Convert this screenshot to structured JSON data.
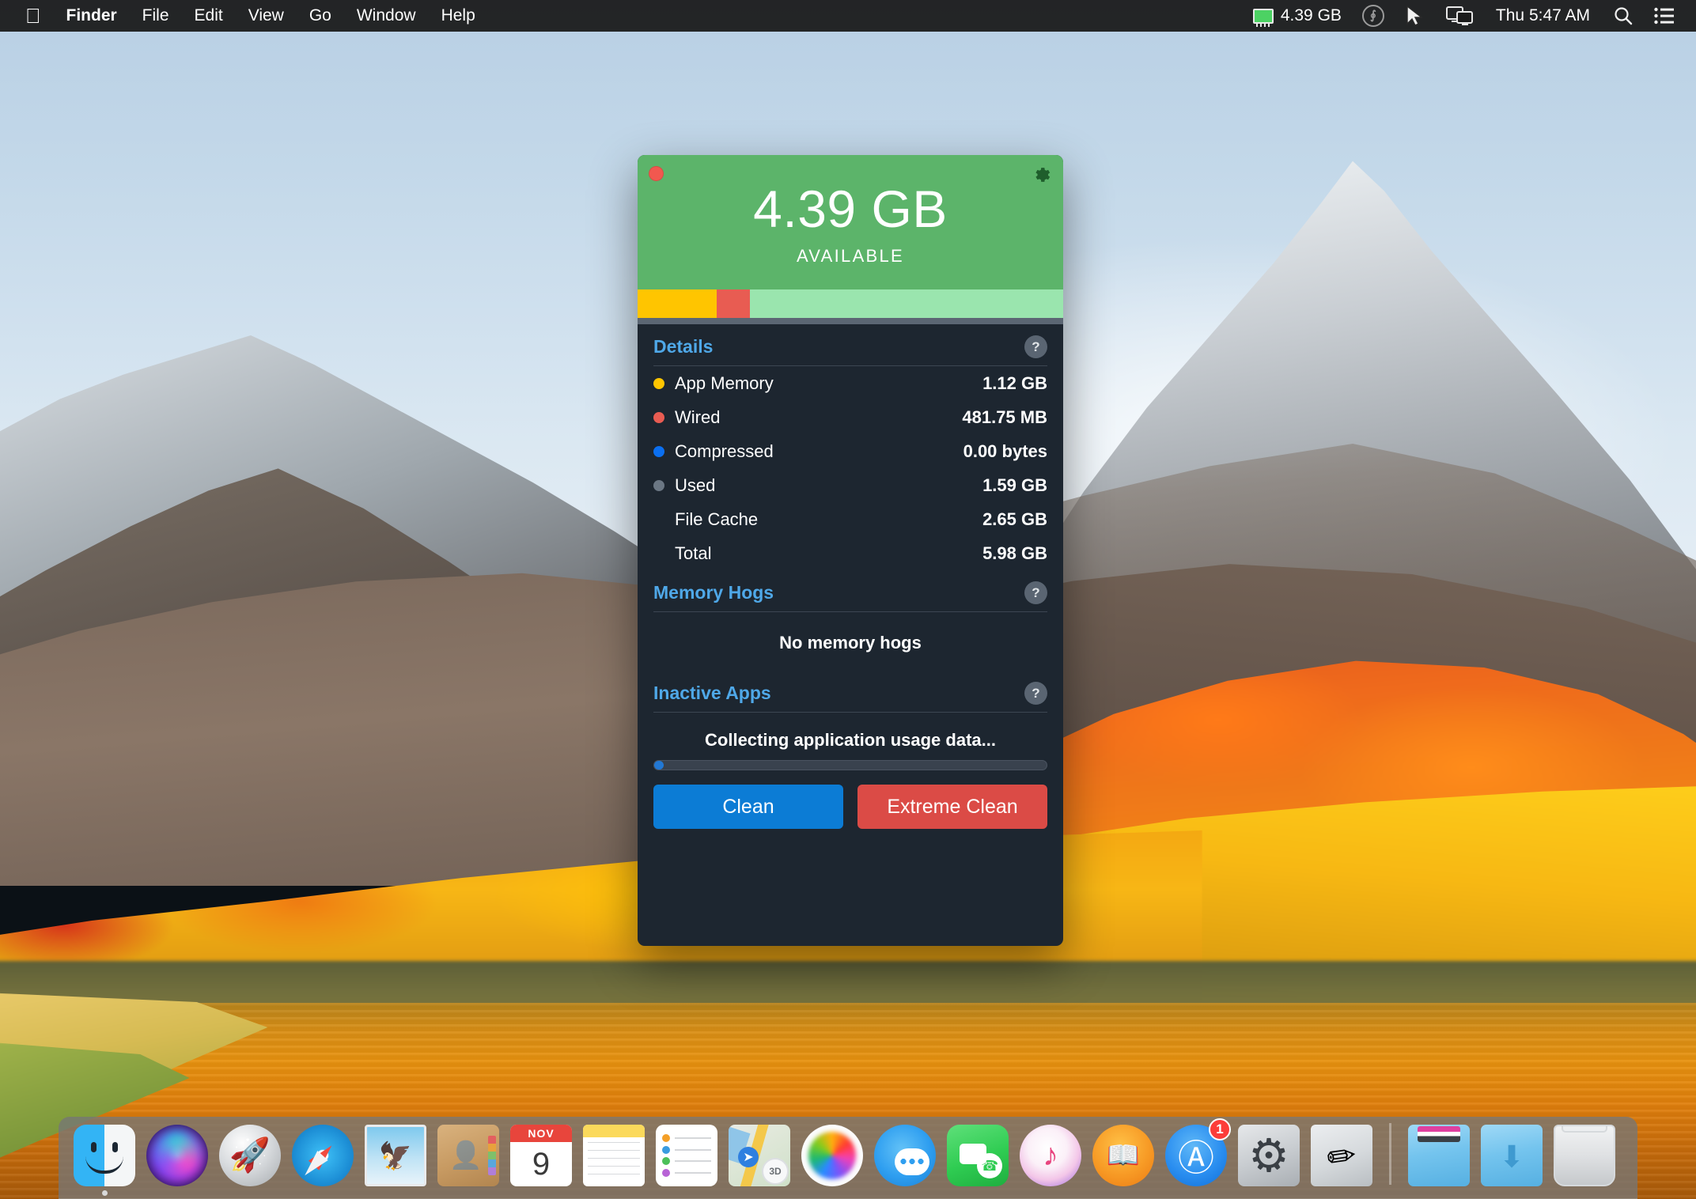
{
  "menubar": {
    "apple_logo": "apple-logo",
    "items": [
      {
        "label": "Finder",
        "bold": true
      },
      {
        "label": "File",
        "bold": false
      },
      {
        "label": "Edit",
        "bold": false
      },
      {
        "label": "View",
        "bold": false
      },
      {
        "label": "Go",
        "bold": false
      },
      {
        "label": "Window",
        "bold": false
      },
      {
        "label": "Help",
        "bold": false
      }
    ],
    "status": {
      "memory_value": "4.39 GB",
      "creative_cloud": "cc-icon",
      "pointer": "pointer-icon",
      "screen_sharing": "screen-sharing-icon",
      "clock": "Thu 5:47 AM",
      "search": "search-icon",
      "notification_center": "list-icon"
    }
  },
  "app_window": {
    "close_button": "close-button",
    "gear_button": "gear-icon",
    "available_value": "4.39 GB",
    "available_label": "AVAILABLE",
    "memory_bar": {
      "segments": [
        {
          "name": "app-memory",
          "color": "#ffc500",
          "percent": 18.6
        },
        {
          "name": "wired",
          "color": "#e85c52",
          "percent": 7.8
        },
        {
          "name": "available",
          "color": "#9ae5ae",
          "percent": 73.6
        }
      ],
      "base_color": "#5b6673"
    },
    "details": {
      "title": "Details",
      "help": "?",
      "rows": [
        {
          "label": "App Memory",
          "value": "1.12 GB",
          "dot": "#ffc500"
        },
        {
          "label": "Wired",
          "value": "481.75 MB",
          "dot": "#e85c52"
        },
        {
          "label": "Compressed",
          "value": "0.00 bytes",
          "dot": "#0b6ff0"
        },
        {
          "label": "Used",
          "value": "1.59 GB",
          "dot": "#6b7784"
        },
        {
          "label": "File Cache",
          "value": "2.65 GB",
          "dot": ""
        },
        {
          "label": "Total",
          "value": "5.98 GB",
          "dot": ""
        }
      ]
    },
    "memory_hogs": {
      "title": "Memory Hogs",
      "help": "?",
      "empty_message": "No memory hogs"
    },
    "inactive_apps": {
      "title": "Inactive Apps",
      "help": "?",
      "status_message": "Collecting application usage data...",
      "progress_percent": 2.5
    },
    "buttons": {
      "clean": "Clean",
      "extreme_clean": "Extreme Clean"
    }
  },
  "dock": {
    "items": [
      {
        "name": "finder",
        "icon": "finder-icon",
        "running": true
      },
      {
        "name": "siri",
        "icon": "siri-icon",
        "running": false
      },
      {
        "name": "launchpad",
        "icon": "launchpad-icon",
        "running": false
      },
      {
        "name": "safari",
        "icon": "safari-icon",
        "running": false
      },
      {
        "name": "mail",
        "icon": "mail-icon",
        "running": false
      },
      {
        "name": "contacts",
        "icon": "contacts-icon",
        "running": false
      },
      {
        "name": "calendar",
        "icon": "calendar-icon",
        "running": false,
        "month": "NOV",
        "day": "9"
      },
      {
        "name": "notes",
        "icon": "notes-icon",
        "running": false
      },
      {
        "name": "reminders",
        "icon": "reminders-icon",
        "running": false
      },
      {
        "name": "maps",
        "icon": "maps-icon",
        "running": false,
        "badge3d": "3D"
      },
      {
        "name": "photos",
        "icon": "photos-icon",
        "running": false
      },
      {
        "name": "messages",
        "icon": "messages-icon",
        "running": false
      },
      {
        "name": "facetime",
        "icon": "facetime-icon",
        "running": false
      },
      {
        "name": "itunes",
        "icon": "itunes-icon",
        "running": false
      },
      {
        "name": "ibooks",
        "icon": "ibooks-icon",
        "running": false
      },
      {
        "name": "app-store",
        "icon": "app-store-icon",
        "running": false,
        "badge": "1"
      },
      {
        "name": "system-preferences",
        "icon": "system-preferences-icon",
        "running": false
      },
      {
        "name": "textedit",
        "icon": "textedit-icon",
        "running": false
      },
      {
        "name": "documents-folder",
        "icon": "folder-icon",
        "running": false
      },
      {
        "name": "downloads-folder",
        "icon": "downloads-icon",
        "running": false
      },
      {
        "name": "trash",
        "icon": "trash-icon",
        "running": false
      }
    ]
  },
  "colors": {
    "accent_green": "#5cb46a",
    "accent_blue": "#4fa8e8",
    "clean_button": "#0c7cd5",
    "extreme_button": "#db4b46",
    "window_bg": "#1d2630"
  }
}
